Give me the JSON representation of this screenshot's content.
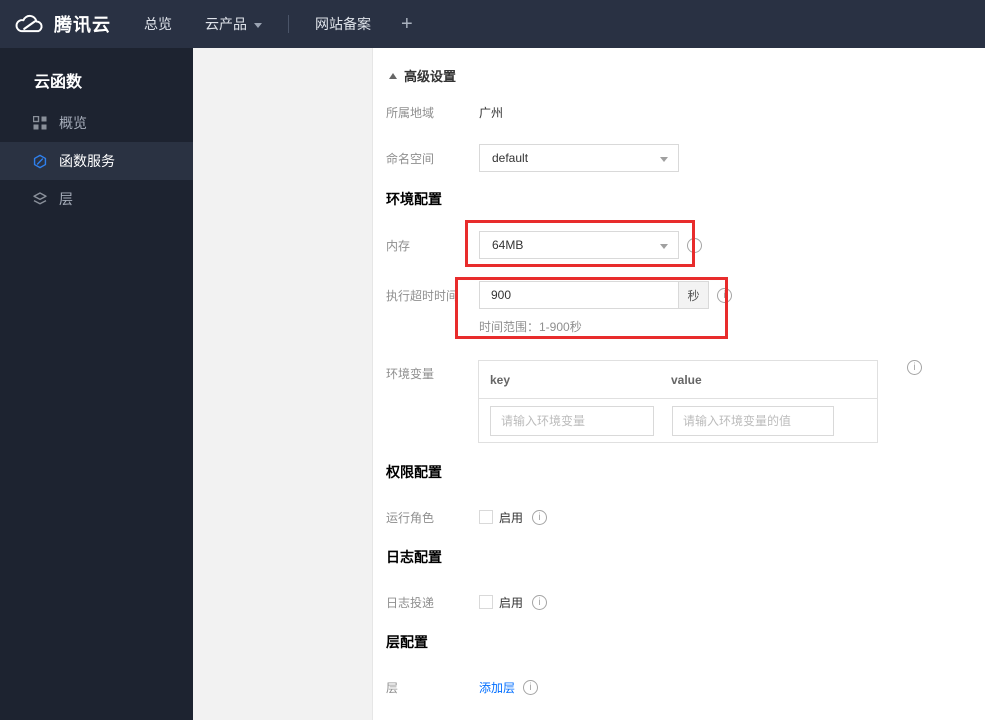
{
  "navbar": {
    "brand": "腾讯云",
    "items": [
      {
        "label": "总览"
      },
      {
        "label": "云产品"
      },
      {
        "label": "网站备案"
      }
    ],
    "plus_label": "+"
  },
  "sidebar": {
    "title": "云函数",
    "items": [
      {
        "label": "概览",
        "icon": "grid-icon",
        "selected": false
      },
      {
        "label": "函数服务",
        "icon": "scf-hexagon-icon",
        "selected": true
      },
      {
        "label": "层",
        "icon": "layers-icon",
        "selected": false
      }
    ]
  },
  "content": {
    "toggle_label": "高级设置",
    "region_label": "所属地域",
    "region_value": "广州",
    "namespace_label": "命名空间",
    "namespace_value": "default",
    "env_section_title": "环境配置",
    "memory_label": "内存",
    "memory_value": "64MB",
    "timeout_label": "执行超时时间",
    "timeout_value": "900",
    "timeout_unit": "秒",
    "timeout_hint": "时间范围：1-900秒",
    "envvar_label": "环境变量",
    "envvar_key_header": "key",
    "envvar_value_header": "value",
    "envvar_key_placeholder": "请输入环境变量",
    "envvar_value_placeholder": "请输入环境变量的值",
    "perm_section_title": "权限配置",
    "role_label": "运行角色",
    "role_enable_label": "启用",
    "log_section_title": "日志配置",
    "log_label": "日志投递",
    "log_enable_label": "启用",
    "layer_section_title": "层配置",
    "layer_label": "层",
    "add_layer_link": "添加层"
  },
  "icons": {
    "info": "i"
  },
  "colors": {
    "navbar_bg": "#293143",
    "sidebar_bg": "#1d2330",
    "sidebar_selected_bg": "#2a3242",
    "accent_red": "#e82c2c",
    "link_blue": "#006eff",
    "scf_icon_blue": "#2f80ed"
  }
}
